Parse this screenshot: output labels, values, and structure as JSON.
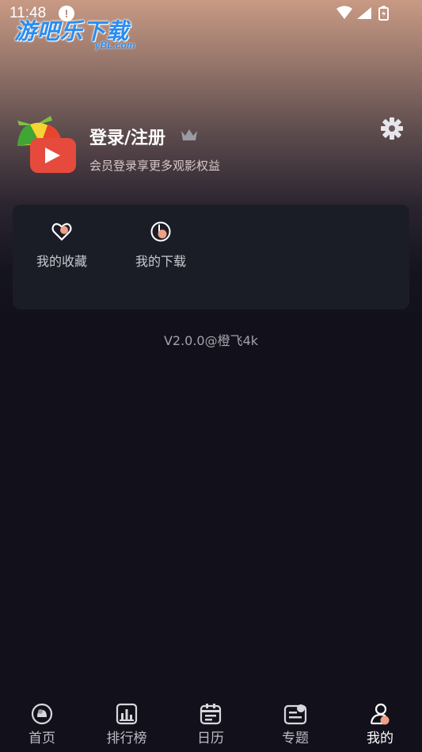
{
  "status_bar": {
    "time": "11:48"
  },
  "watermark": {
    "main": "游吧乐下载",
    "sub": "yBL.com"
  },
  "profile": {
    "title": "登录/注册",
    "subtitle": "会员登录享更多观影权益"
  },
  "quick_actions": [
    {
      "label": "我的收藏",
      "icon": "heart-icon"
    },
    {
      "label": "我的下载",
      "icon": "download-icon"
    }
  ],
  "version": "V2.0.0@橙飞4k",
  "nav": [
    {
      "label": "首页",
      "icon": "home-icon",
      "active": false
    },
    {
      "label": "排行榜",
      "icon": "ranking-icon",
      "active": false
    },
    {
      "label": "日历",
      "icon": "calendar-icon",
      "active": false
    },
    {
      "label": "专题",
      "icon": "topic-icon",
      "active": false
    },
    {
      "label": "我的",
      "icon": "profile-icon",
      "active": true
    }
  ],
  "colors": {
    "background": "#12111b",
    "card": "#1b1d26",
    "accent": "#f0a085",
    "watermark": "#2a8cf0"
  }
}
